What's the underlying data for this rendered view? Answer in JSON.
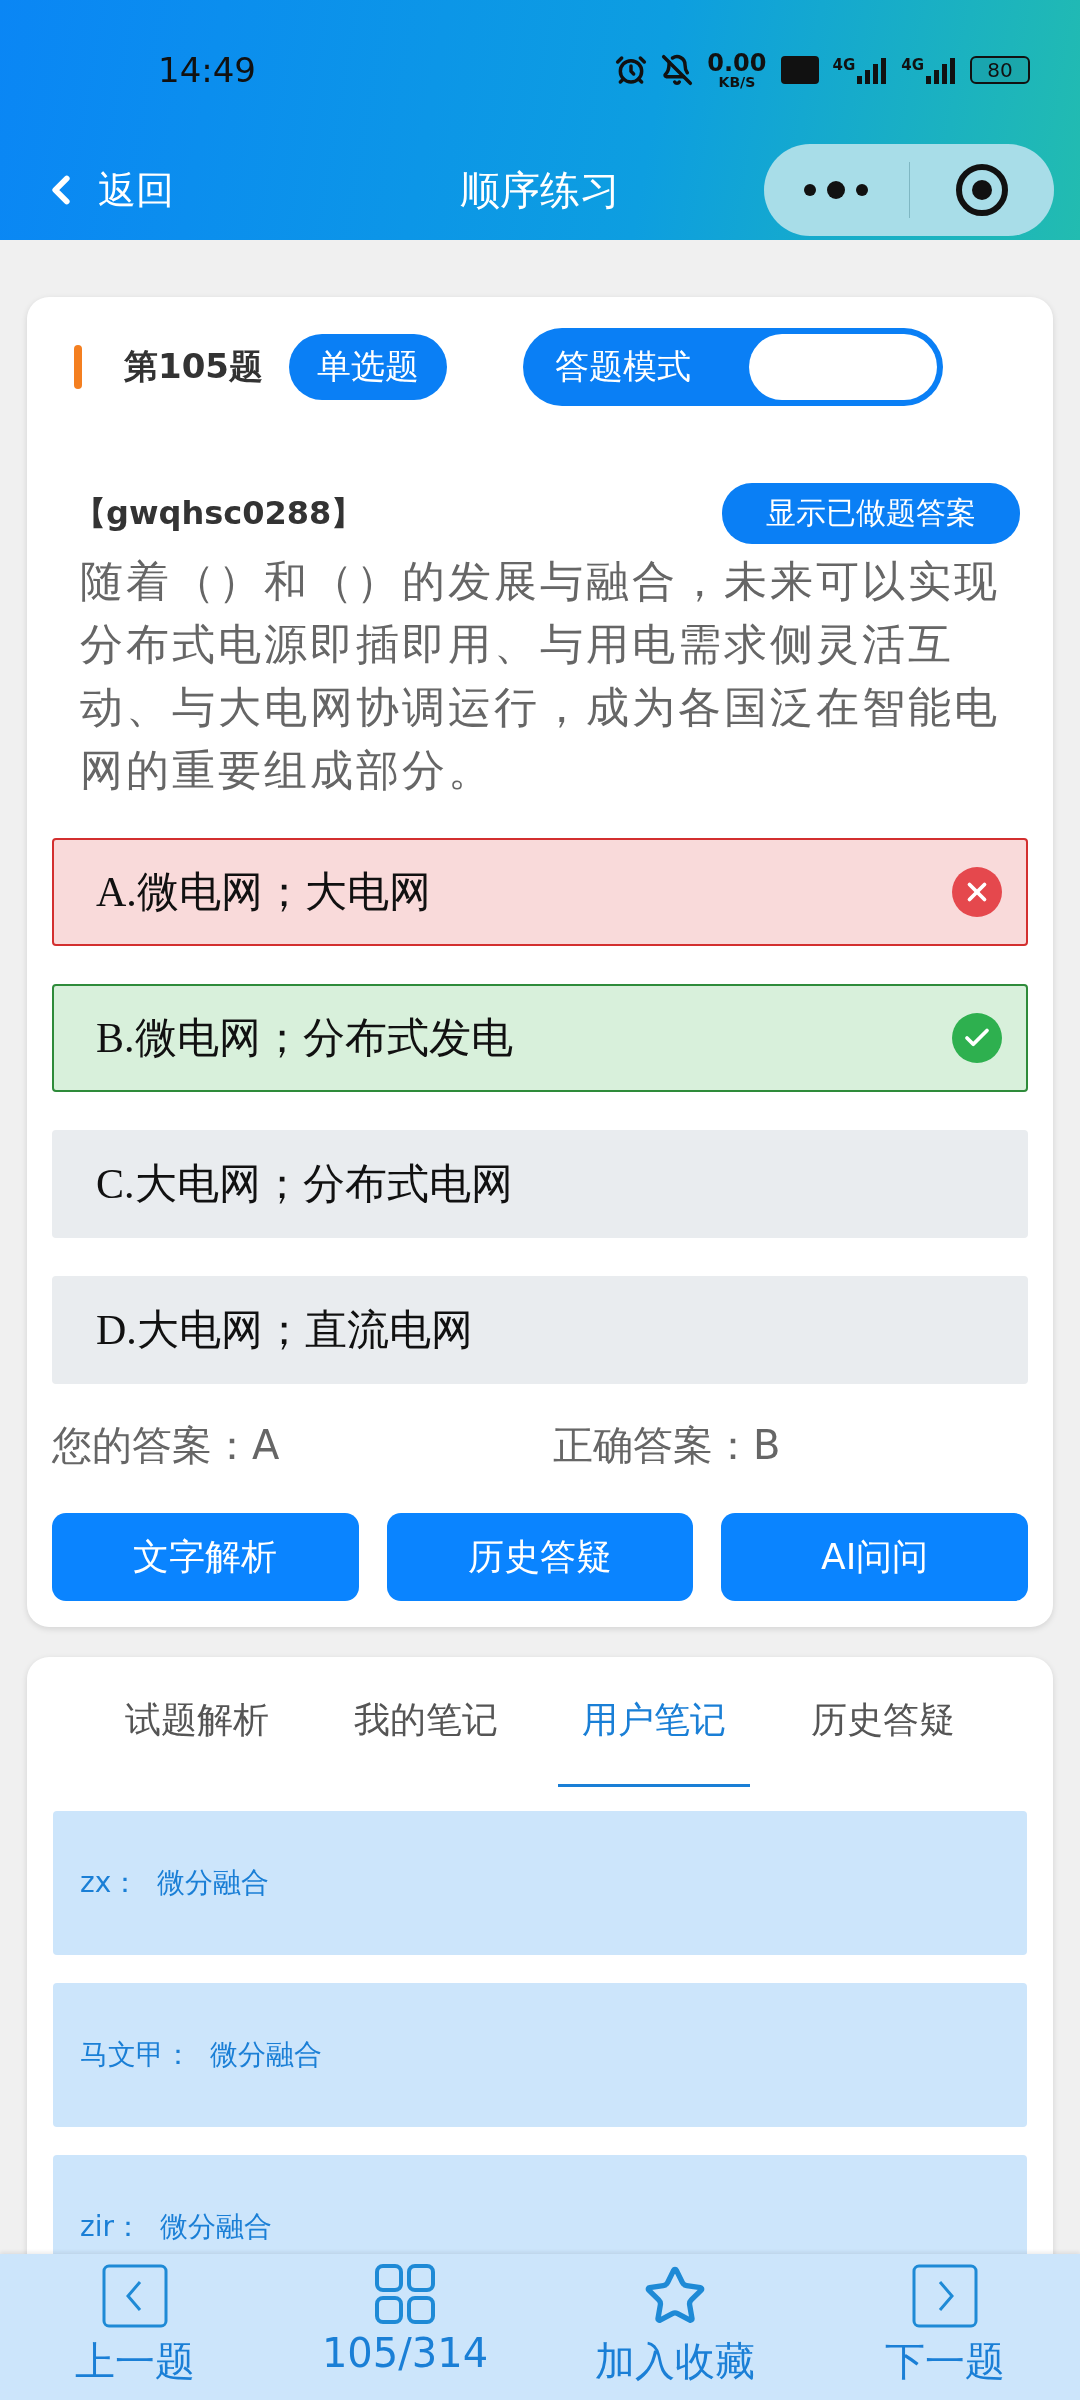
{
  "status_bar": {
    "time": "14:49",
    "speed": "0.00",
    "speed_unit": "KB/S",
    "network": [
      "4G",
      "4G"
    ],
    "battery": "80"
  },
  "nav": {
    "back": "返回",
    "title": "顺序练习"
  },
  "question": {
    "number": "第105题",
    "type": "单选题",
    "mode": {
      "label": "答题模式",
      "on": true
    },
    "code": "【gwqhsc0288】",
    "show_answers_button": "显示已做题答案",
    "text": "随着（）和（）的发展与融合，未来可以实现分布式电源即插即用、与用电需求侧灵活互动、与大电网协调运行，成为各国泛在智能电网的重要组成部分。",
    "options": [
      {
        "text": "A.微电网；大电网",
        "kind": "wrong"
      },
      {
        "text": "B.微电网；分布式发电",
        "kind": "correct"
      },
      {
        "text": "C.大电网；分布式电网",
        "kind": "plain"
      },
      {
        "text": "D.大电网；直流电网",
        "kind": "plain"
      }
    ],
    "your_answer": "您的答案：A",
    "correct_answer": "正确答案：B",
    "buttons": [
      "文字解析",
      "历史答疑",
      "AI问问"
    ]
  },
  "tabs": [
    {
      "label": "试题解析",
      "selected": false
    },
    {
      "label": "我的笔记",
      "selected": false
    },
    {
      "label": "用户笔记",
      "selected": true
    },
    {
      "label": "历史答疑",
      "selected": false
    }
  ],
  "notes": [
    {
      "user": "zx：",
      "text": "微分融合"
    },
    {
      "user": "马文甲：",
      "text": "微分融合"
    },
    {
      "user": "zir：",
      "text": "微分融合"
    }
  ],
  "bottom_nav": [
    {
      "label": "上一题",
      "kind": "prev"
    },
    {
      "label": "105/314",
      "kind": "grid"
    },
    {
      "label": "加入收藏",
      "kind": "star"
    },
    {
      "label": "下一题",
      "kind": "next"
    }
  ]
}
